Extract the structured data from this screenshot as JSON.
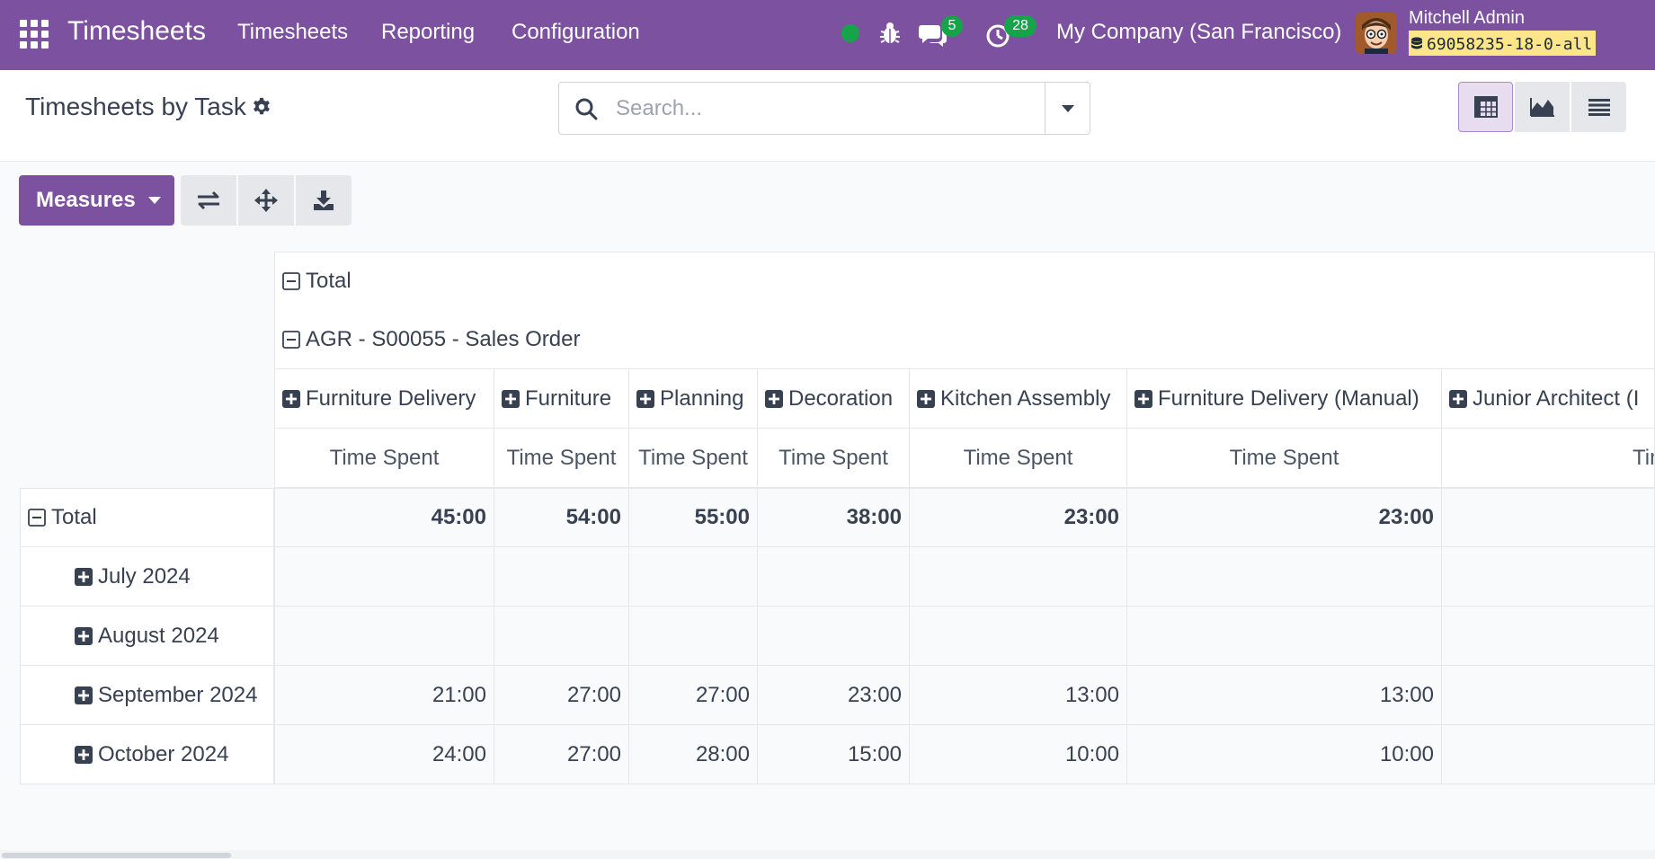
{
  "navbar": {
    "app_name": "Timesheets",
    "menus": [
      "Timesheets",
      "Reporting",
      "Configuration"
    ],
    "messages_count": "5",
    "activities_count": "28",
    "company": "My Company (San Francisco)",
    "user_name": "Mitchell Admin",
    "database": "69058235-18-0-all",
    "colors": {
      "navbar": "#7c52a0",
      "badge": "#16a34a",
      "db_badge": "#fde68a"
    }
  },
  "control_panel": {
    "title": "Timesheets by Task",
    "search_placeholder": "Search...",
    "views": [
      "pivot-icon",
      "graph-icon",
      "list-icon"
    ],
    "active_view": "pivot-icon"
  },
  "toolbar": {
    "measures_label": "Measures",
    "tools": [
      "flip-axis-icon",
      "expand-all-icon",
      "download-icon"
    ]
  },
  "pivot": {
    "col_total_label": "Total",
    "col_group_label": "AGR - S00055 - Sales Order",
    "columns": [
      "Furniture Delivery",
      "Furniture",
      "Planning",
      "Decoration",
      "Kitchen Assembly",
      "Furniture Delivery (Manual)",
      "Junior Architect (I"
    ],
    "measure_label": "Time Spent",
    "row_total_label": "Total",
    "totals": [
      "45:00",
      "54:00",
      "55:00",
      "38:00",
      "23:00",
      "23:00",
      ""
    ],
    "rows": [
      {
        "label": "July 2024",
        "values": [
          "",
          "",
          "",
          "",
          "",
          "",
          ""
        ]
      },
      {
        "label": "August 2024",
        "values": [
          "",
          "",
          "",
          "",
          "",
          "",
          ""
        ]
      },
      {
        "label": "September 2024",
        "values": [
          "21:00",
          "27:00",
          "27:00",
          "23:00",
          "13:00",
          "13:00",
          ""
        ]
      },
      {
        "label": "October 2024",
        "values": [
          "24:00",
          "27:00",
          "28:00",
          "15:00",
          "10:00",
          "10:00",
          ""
        ]
      }
    ]
  }
}
